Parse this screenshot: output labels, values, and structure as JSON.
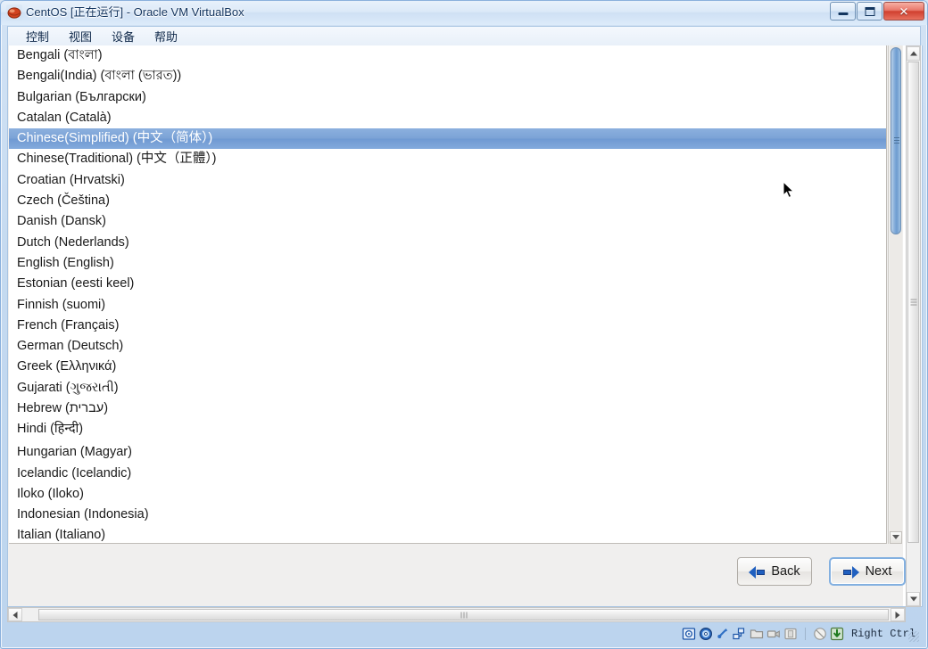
{
  "window": {
    "title": "CentOS [正在运行] - Oracle VM VirtualBox",
    "icon": "virtualbox-logo-icon",
    "controls": {
      "minimize": "minimize-button",
      "maximize": "maximize-button",
      "close": "✕"
    }
  },
  "menubar": {
    "items": [
      {
        "label": "控制",
        "name": "menu-control"
      },
      {
        "label": "视图",
        "name": "menu-view"
      },
      {
        "label": "设备",
        "name": "menu-devices"
      },
      {
        "label": "帮助",
        "name": "menu-help"
      }
    ]
  },
  "installer": {
    "language_list": [
      {
        "label": "Bengali (বাংলা)",
        "selected": false,
        "gap_before": false
      },
      {
        "label": "Bengali(India) (বাংলা (ভারত))",
        "selected": false,
        "gap_before": false
      },
      {
        "label": "Bulgarian (Български)",
        "selected": false,
        "gap_before": false
      },
      {
        "label": "Catalan (Català)",
        "selected": false,
        "gap_before": false
      },
      {
        "label": "Chinese(Simplified) (中文（简体）)",
        "selected": true,
        "gap_before": false
      },
      {
        "label": "Chinese(Traditional) (中文（正體）)",
        "selected": false,
        "gap_before": false
      },
      {
        "label": "Croatian (Hrvatski)",
        "selected": false,
        "gap_before": false
      },
      {
        "label": "Czech (Čeština)",
        "selected": false,
        "gap_before": false
      },
      {
        "label": "Danish (Dansk)",
        "selected": false,
        "gap_before": false
      },
      {
        "label": "Dutch (Nederlands)",
        "selected": false,
        "gap_before": false
      },
      {
        "label": "English (English)",
        "selected": false,
        "gap_before": false
      },
      {
        "label": "Estonian (eesti keel)",
        "selected": false,
        "gap_before": false
      },
      {
        "label": "Finnish (suomi)",
        "selected": false,
        "gap_before": false
      },
      {
        "label": "French (Français)",
        "selected": false,
        "gap_before": false
      },
      {
        "label": "German (Deutsch)",
        "selected": false,
        "gap_before": false
      },
      {
        "label": "Greek (Ελληνικά)",
        "selected": false,
        "gap_before": false
      },
      {
        "label": "Gujarati (ગુજરાતી)",
        "selected": false,
        "gap_before": false
      },
      {
        "label": "Hebrew (עברית)",
        "selected": false,
        "gap_before": false
      },
      {
        "label": "Hindi (हिन्दी)",
        "selected": false,
        "gap_before": false
      },
      {
        "label": "Hungarian (Magyar)",
        "selected": false,
        "gap_before": true
      },
      {
        "label": "Icelandic (Icelandic)",
        "selected": false,
        "gap_before": false
      },
      {
        "label": "Iloko (Iloko)",
        "selected": false,
        "gap_before": false
      },
      {
        "label": "Indonesian (Indonesia)",
        "selected": false,
        "gap_before": false
      },
      {
        "label": "Italian (Italiano)",
        "selected": false,
        "gap_before": false
      }
    ],
    "buttons": {
      "back": "Back",
      "next": "Next"
    },
    "selection_color": "#7ba2d6"
  },
  "statusbar": {
    "icons": [
      {
        "name": "hard-disk-icon"
      },
      {
        "name": "optical-disk-icon"
      },
      {
        "name": "usb-icon"
      },
      {
        "name": "network-icon"
      },
      {
        "name": "shared-folders-icon"
      },
      {
        "name": "video-capture-icon"
      },
      {
        "name": "display-icon"
      },
      {
        "name": "mouse-integration-icon"
      },
      {
        "name": "host-key-icon"
      }
    ],
    "host_key": "Right Ctrl"
  }
}
